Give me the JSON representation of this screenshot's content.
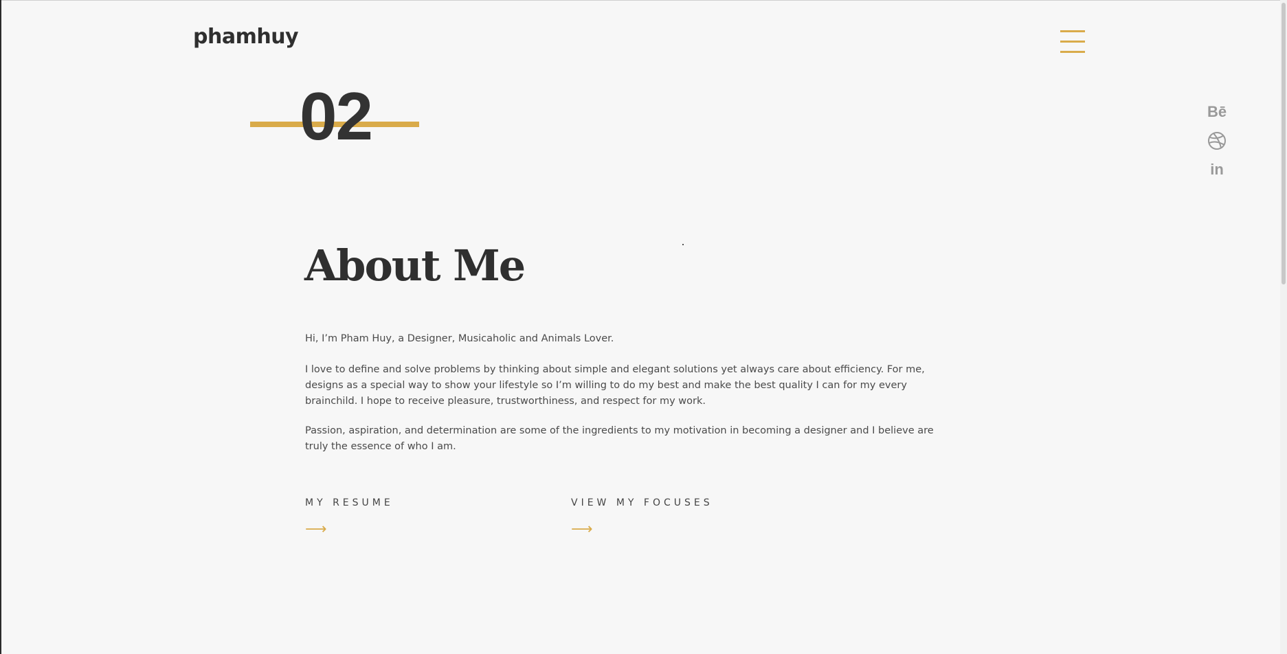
{
  "header": {
    "logo": "phamhuy",
    "menu_icon": "hamburger-icon"
  },
  "social": {
    "items": [
      {
        "name": "behance",
        "label": "Bē",
        "icon": "behance-icon"
      },
      {
        "name": "dribbble",
        "label": "",
        "icon": "dribbble-icon"
      },
      {
        "name": "linkedin",
        "label": "in",
        "icon": "linkedin-icon"
      }
    ]
  },
  "section": {
    "number": "02",
    "title": "About Me"
  },
  "content": {
    "intro": "Hi, I’m Pham Huy, a Designer, Musicaholic and Animals Lover.",
    "body1": "I love to define and solve problems by thinking about simple and elegant solutions yet always care about efficiency. For me, designs as a special way to show your lifestyle so I’m willing to do my best and make the best quality I can for my every brainchild. I hope to receive pleasure, trustworthiness, and respect for my work.",
    "body2": "Passion, aspiration, and determination are some of the ingredients to my motivation in becoming a designer and I believe are truly the essence of who I am."
  },
  "links": {
    "resume_label": "MY RESUME",
    "focuses_label": "VIEW MY FOCUSES",
    "arrow": "⟶",
    "arrow_icon": "arrow-right-icon"
  },
  "colors": {
    "accent": "#d9ab4a",
    "background": "#f7f7f7",
    "text": "#333333"
  }
}
